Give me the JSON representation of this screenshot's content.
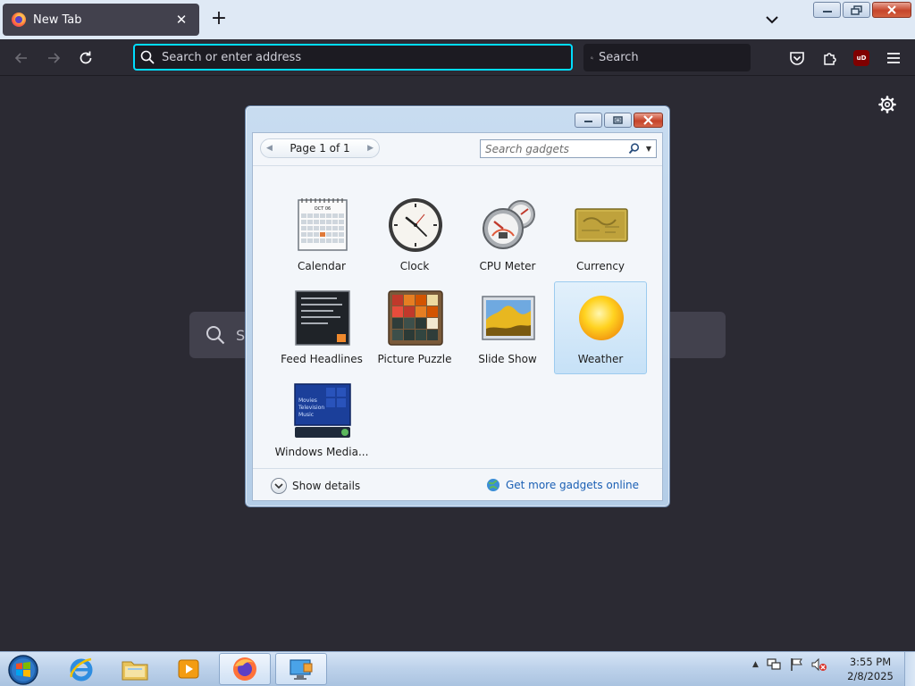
{
  "browser": {
    "tab": {
      "title": "New Tab"
    },
    "urlbar": {
      "placeholder": "Search or enter address"
    },
    "searchbar": {
      "placeholder": "Search"
    },
    "ublock_label": "uD"
  },
  "newtab": {
    "search_hint": "S"
  },
  "gadgets_window": {
    "pager": {
      "label": "Page 1 of 1"
    },
    "search": {
      "placeholder": "Search gadgets"
    },
    "items": [
      {
        "label": "Calendar",
        "icon": "calendar-gadget-icon",
        "selected": false
      },
      {
        "label": "Clock",
        "icon": "clock-gadget-icon",
        "selected": false
      },
      {
        "label": "CPU Meter",
        "icon": "cpu-meter-gadget-icon",
        "selected": false
      },
      {
        "label": "Currency",
        "icon": "currency-gadget-icon",
        "selected": false
      },
      {
        "label": "Feed Headlines",
        "icon": "feed-headlines-gadget-icon",
        "selected": false
      },
      {
        "label": "Picture Puzzle",
        "icon": "picture-puzzle-gadget-icon",
        "selected": false
      },
      {
        "label": "Slide Show",
        "icon": "slide-show-gadget-icon",
        "selected": false
      },
      {
        "label": "Weather",
        "icon": "weather-gadget-icon",
        "selected": true
      },
      {
        "label": "Windows Media...",
        "icon": "windows-media-center-gadget-icon",
        "selected": false
      }
    ],
    "calendar_month": "OCT 06",
    "media_lines": [
      "Movies",
      "Television",
      "Music"
    ],
    "show_details": "Show details",
    "more_online": "Get more gadgets online"
  },
  "taskbar": {
    "time": "3:55 PM",
    "date": "2/8/2025"
  },
  "colors": {
    "accent": "#00ddff",
    "browser_bg": "#2b2a33",
    "link": "#1a5fb4",
    "selection": "#c6e1f7"
  }
}
